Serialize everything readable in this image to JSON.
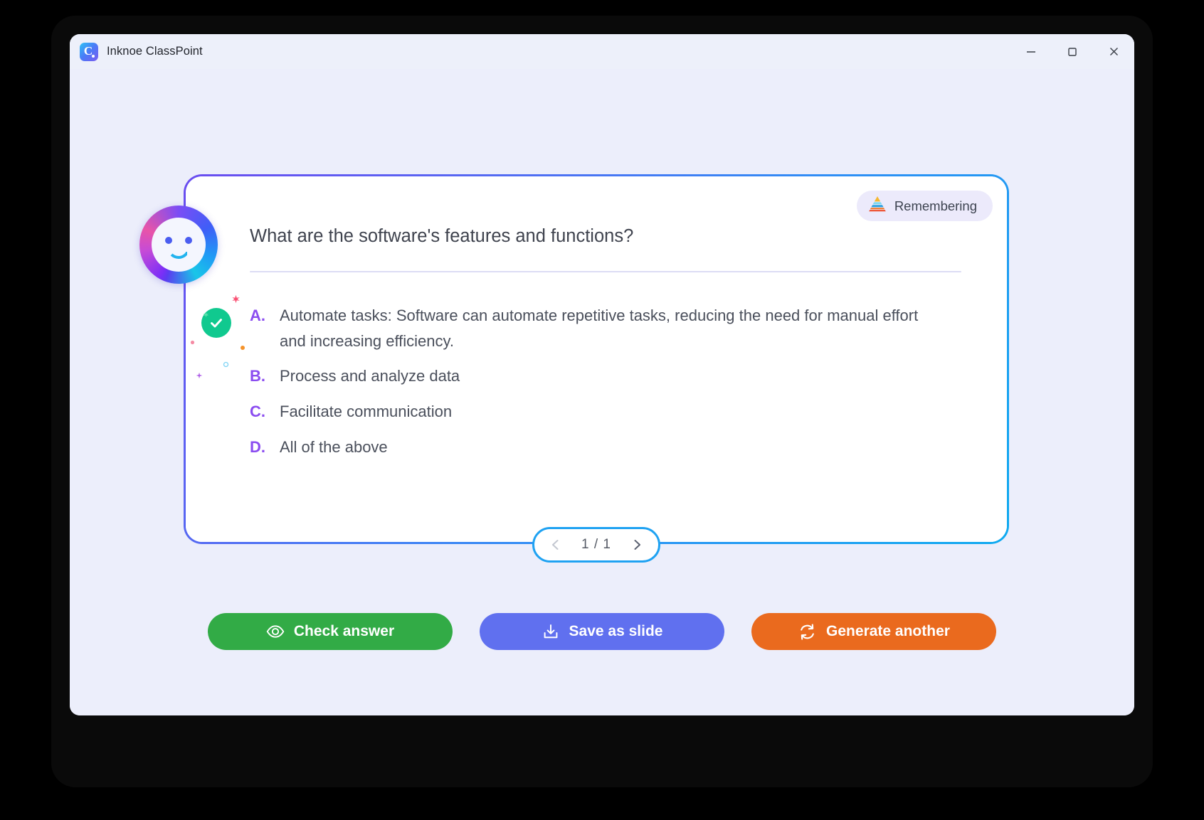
{
  "window": {
    "title": "Inknoe ClassPoint",
    "logo_icon": "classpoint-logo-icon",
    "controls": {
      "minimize": "minimize-icon",
      "maximize": "maximize-icon",
      "close": "close-icon"
    }
  },
  "colors": {
    "background": "#eceefb",
    "card_border_start": "#6a4df0",
    "card_border_end": "#0eaaf0",
    "option_letter": "#8b4df0",
    "correct_green": "#10c98f",
    "check_button": "#32ab46",
    "save_button": "#6070ef",
    "generate_button": "#ea6a1e",
    "pagination_border": "#1fa2f2",
    "badge_background": "#eceafb"
  },
  "card": {
    "avatar": {
      "icon": "ai-assistant-smiley-avatar"
    },
    "taxonomy_badge": {
      "label": "Remembering",
      "icon": "blooms-taxonomy-pyramid-icon"
    },
    "question": "What are the software's features and functions?",
    "options": [
      {
        "letter": "A.",
        "text": "Automate tasks: Software can automate repetitive tasks, reducing the need for manual effort and increasing efficiency.",
        "correct": true
      },
      {
        "letter": "B.",
        "text": "Process and analyze data",
        "correct": false
      },
      {
        "letter": "C.",
        "text": "Facilitate communication",
        "correct": false
      },
      {
        "letter": "D.",
        "text": "All of the above",
        "correct": false
      }
    ],
    "correct_marker_icon": "check-circle-icon"
  },
  "pagination": {
    "indicator": "1 / 1",
    "prev_icon": "chevron-left-icon",
    "next_icon": "chevron-right-icon",
    "prev_enabled": false,
    "next_enabled": true
  },
  "actions": [
    {
      "id": "check",
      "label": "Check answer",
      "icon": "eye-icon"
    },
    {
      "id": "save",
      "label": "Save as slide",
      "icon": "download-icon"
    },
    {
      "id": "generate",
      "label": "Generate another",
      "icon": "refresh-icon"
    }
  ]
}
